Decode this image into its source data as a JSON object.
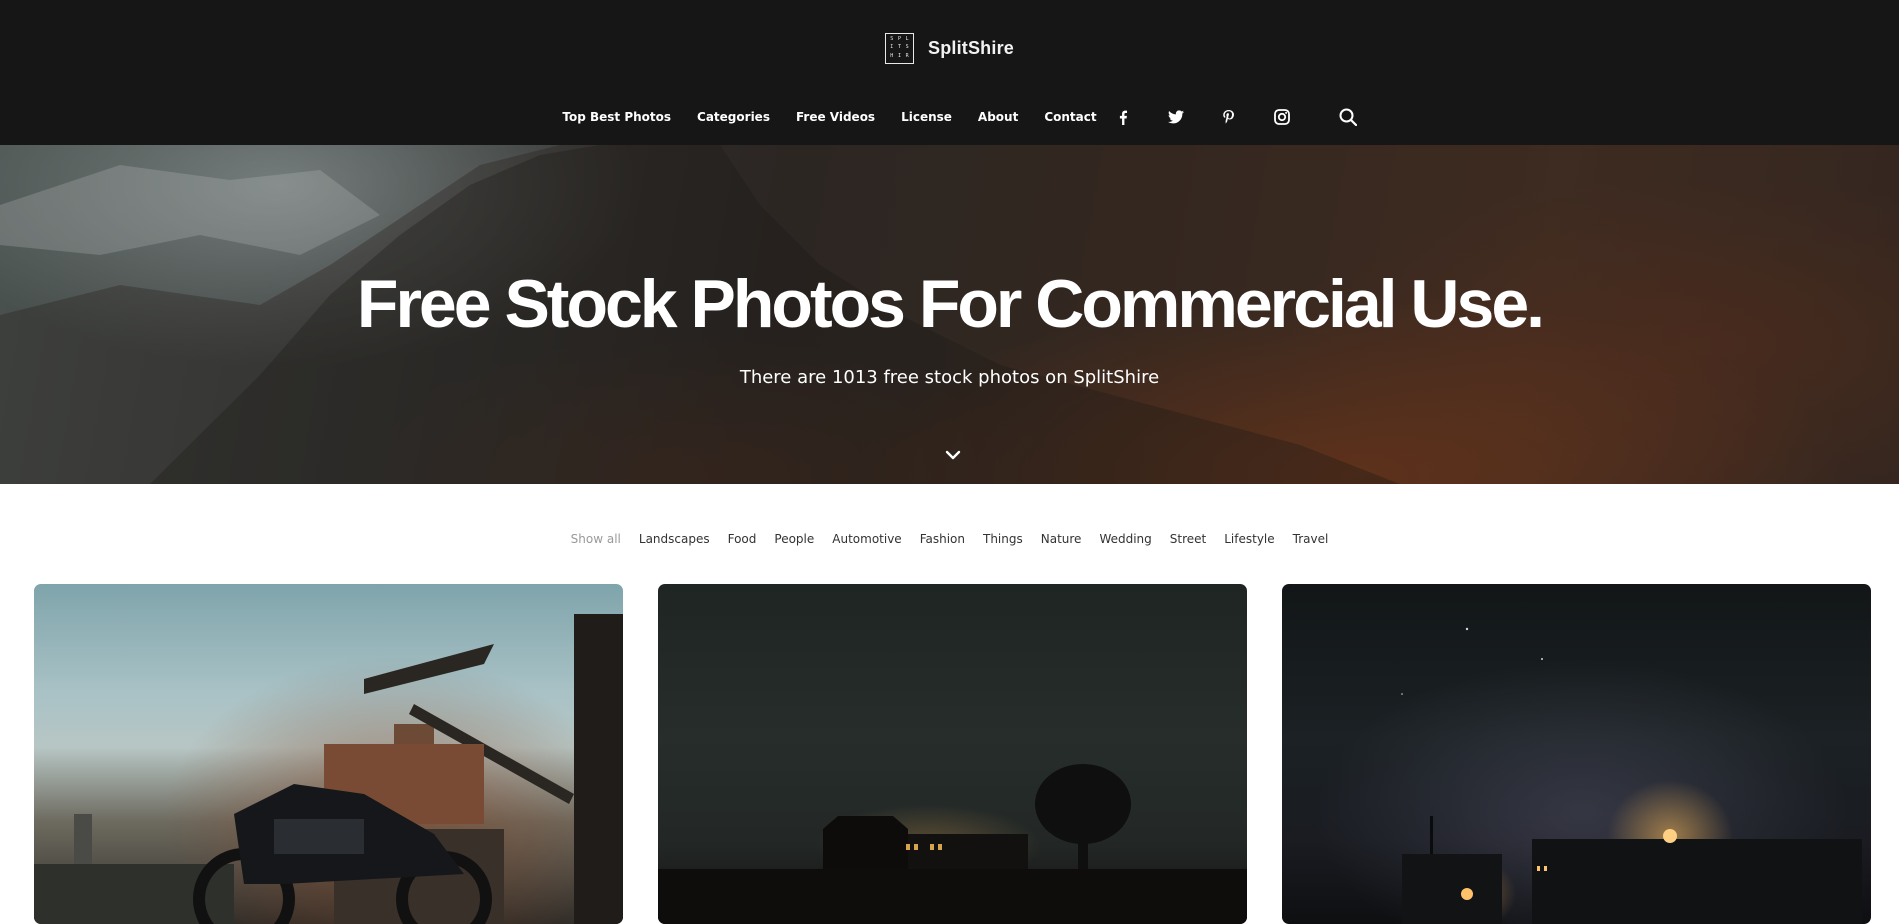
{
  "brand": {
    "name": "SplitShire",
    "logo_letters": [
      "S",
      "P",
      "L",
      "I",
      "T",
      "S",
      "H",
      "I",
      "R"
    ]
  },
  "nav": {
    "items": [
      {
        "label": "Top Best Photos"
      },
      {
        "label": "Categories"
      },
      {
        "label": "Free Videos"
      },
      {
        "label": "License"
      },
      {
        "label": "About"
      },
      {
        "label": "Contact"
      }
    ],
    "social_icons": [
      "facebook-icon",
      "twitter-icon",
      "pinterest-icon",
      "instagram-icon"
    ],
    "search_icon": "search-icon"
  },
  "hero": {
    "title": "Free Stock Photos For Commercial Use.",
    "subtitle": "There are 1013 free stock photos on SplitShire",
    "scroll_icon": "chevron-down-icon"
  },
  "filters": {
    "items": [
      {
        "label": "Show all",
        "active": true
      },
      {
        "label": "Landscapes",
        "active": false
      },
      {
        "label": "Food",
        "active": false
      },
      {
        "label": "People",
        "active": false
      },
      {
        "label": "Automotive",
        "active": false
      },
      {
        "label": "Fashion",
        "active": false
      },
      {
        "label": "Things",
        "active": false
      },
      {
        "label": "Nature",
        "active": false
      },
      {
        "label": "Wedding",
        "active": false
      },
      {
        "label": "Street",
        "active": false
      },
      {
        "label": "Lifestyle",
        "active": false
      },
      {
        "label": "Travel",
        "active": false
      }
    ]
  },
  "colors": {
    "header_bg": "#161616",
    "text_on_dark": "#ffffff",
    "filter_text": "#333333",
    "filter_active": "#9a9a9a"
  }
}
